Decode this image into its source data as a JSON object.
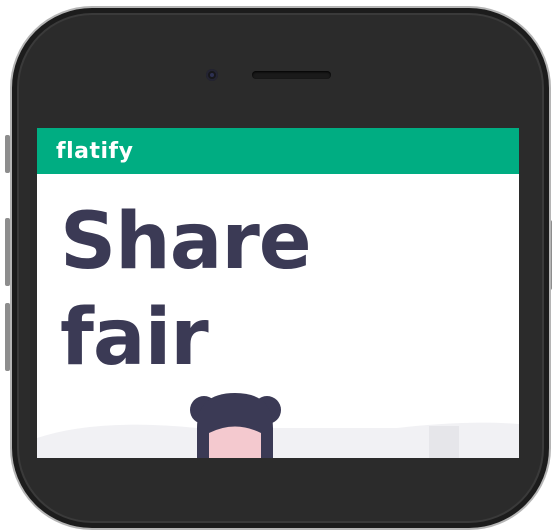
{
  "app": {
    "logo_text": "flatify",
    "headline_line1": "Share",
    "headline_line2": "fair"
  },
  "colors": {
    "brand": "#00ad82",
    "headline": "#3b3a55",
    "phone_body": "#2b2b2b"
  },
  "icons": [
    "camera-icon",
    "speaker-grille"
  ]
}
